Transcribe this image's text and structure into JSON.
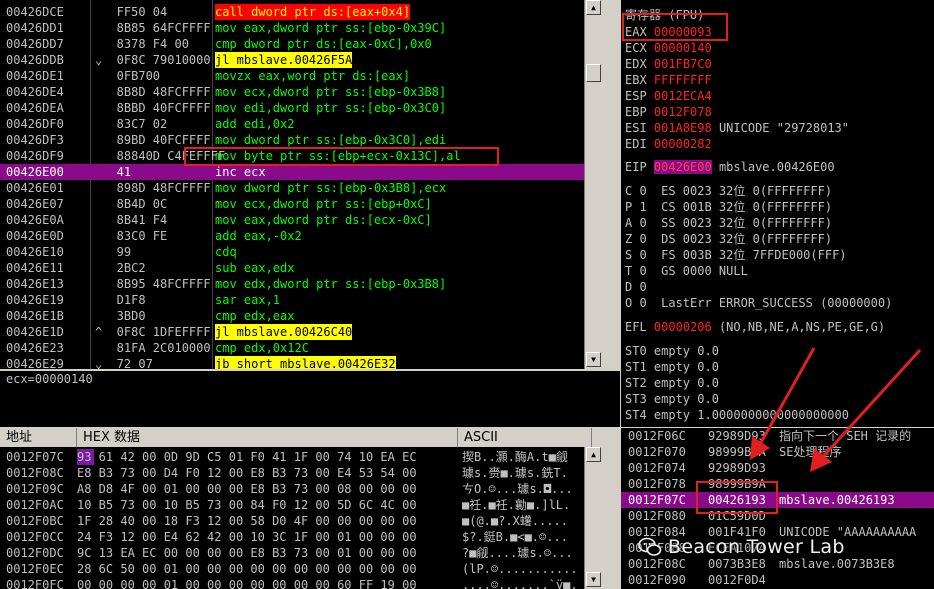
{
  "disasm": {
    "rows": [
      {
        "addr": "00426DCE",
        "hex": "   FF50 04",
        "asm": "call dword ptr ds:[eax+0x4]",
        "style": "call"
      },
      {
        "addr": "00426DD1",
        "hex": "   8B85 64FCFFFF",
        "asm": "mov eax,dword ptr ss:[ebp-0x39C]"
      },
      {
        "addr": "00426DD7",
        "hex": "   8378 F4 00",
        "asm": "cmp dword ptr ds:[eax-0xC],0x0"
      },
      {
        "addr": "00426DDB",
        "hex": "⌄  0F8C 79010000",
        "asm": "jl mbslave.00426F5A",
        "style": "jl"
      },
      {
        "addr": "00426DE1",
        "hex": "   0FB700",
        "asm": "movzx eax,word ptr ds:[eax]"
      },
      {
        "addr": "00426DE4",
        "hex": "   8B8D 48FCFFFF",
        "asm": "mov ecx,dword ptr ss:[ebp-0x3B8]"
      },
      {
        "addr": "00426DEA",
        "hex": "   8BBD 40FCFFFF",
        "asm": "mov edi,dword ptr ss:[ebp-0x3C0]"
      },
      {
        "addr": "00426DF0",
        "hex": "   83C7 02",
        "asm": "add edi,0x2"
      },
      {
        "addr": "00426DF3",
        "hex": "   89BD 40FCFFFF",
        "asm": "mov dword ptr ss:[ebp-0x3C0],edi"
      },
      {
        "addr": "00426DF9",
        "hex": "   88840D C4FEFFFF",
        "asm": "mov byte ptr ss:[ebp+ecx-0x13C],al"
      },
      {
        "addr": "00426E00",
        "hex": "   41",
        "asm": "inc ecx",
        "selected": true
      },
      {
        "addr": "00426E01",
        "hex": "   898D 48FCFFFF",
        "asm": "mov dword ptr ss:[ebp-0x3B8],ecx"
      },
      {
        "addr": "00426E07",
        "hex": "   8B4D 0C",
        "asm": "mov ecx,dword ptr ss:[ebp+0xC]"
      },
      {
        "addr": "00426E0A",
        "hex": "   8B41 F4",
        "asm": "mov eax,dword ptr ds:[ecx-0xC]"
      },
      {
        "addr": "00426E0D",
        "hex": "   83C0 FE",
        "asm": "add eax,-0x2"
      },
      {
        "addr": "00426E10",
        "hex": "   99",
        "asm": "cdq"
      },
      {
        "addr": "00426E11",
        "hex": "   2BC2",
        "asm": "sub eax,edx"
      },
      {
        "addr": "00426E13",
        "hex": "   8B95 48FCFFFF",
        "asm": "mov edx,dword ptr ss:[ebp-0x3B8]"
      },
      {
        "addr": "00426E19",
        "hex": "   D1F8",
        "asm": "sar eax,1"
      },
      {
        "addr": "00426E1B",
        "hex": "   3BD0",
        "asm": "cmp edx,eax"
      },
      {
        "addr": "00426E1D",
        "hex": "^  0F8C 1DFEFFFF",
        "asm": "jl mbslave.00426C40",
        "style": "jl"
      },
      {
        "addr": "00426E23",
        "hex": "   81FA 2C010000",
        "asm": "cmp edx,0x12C"
      },
      {
        "addr": "00426E29",
        "hex": "⌄  72 07",
        "asm": "jb short mbslave.00426E32",
        "style": "jl"
      }
    ]
  },
  "info": {
    "text": "ecx=00000140"
  },
  "registers": {
    "header": "寄存器 (FPU)",
    "gp": [
      {
        "name": "EAX",
        "value": "00000093",
        "comment": ""
      },
      {
        "name": "ECX",
        "value": "00000140",
        "comment": ""
      },
      {
        "name": "EDX",
        "value": "001FB7C0",
        "comment": ""
      },
      {
        "name": "EBX",
        "value": "FFFFFFFF",
        "comment": ""
      },
      {
        "name": "ESP",
        "value": "0012ECA4",
        "comment": ""
      },
      {
        "name": "EBP",
        "value": "0012F078",
        "comment": ""
      },
      {
        "name": "ESI",
        "value": "001A8E98",
        "comment": "UNICODE \"29728013\""
      },
      {
        "name": "EDI",
        "value": "00000282",
        "comment": ""
      }
    ],
    "eip": {
      "name": "EIP",
      "value": "00426E00",
      "comment": "mbslave.00426E00"
    },
    "flags": [
      {
        "text": "C 0  ES 0023 32位 0(FFFFFFFF)"
      },
      {
        "text": "P 1  CS 001B 32位 0(FFFFFFFF)"
      },
      {
        "text": "A 0  SS 0023 32位 0(FFFFFFFF)"
      },
      {
        "text": "Z 0  DS 0023 32位 0(FFFFFFFF)"
      },
      {
        "text": "S 0  FS 003B 32位 7FFDE000(FFF)"
      },
      {
        "text": "T 0  GS 0000 NULL"
      },
      {
        "text": "D 0"
      },
      {
        "text": "O 0  LastErr ERROR_SUCCESS (00000000)"
      }
    ],
    "efl": {
      "name": "EFL",
      "value": "00000206",
      "comment": "(NO,NB,NE,A,NS,PE,GE,G)"
    },
    "fpu": [
      {
        "text": "ST0 empty 0.0"
      },
      {
        "text": "ST1 empty 0.0"
      },
      {
        "text": "ST2 empty 0.0"
      },
      {
        "text": "ST3 empty 0.0"
      },
      {
        "text": "ST4 empty 1.0000000000000000000"
      }
    ]
  },
  "hexdump": {
    "headers": {
      "addr": "地址",
      "hex": "HEX 数据",
      "ascii": "ASCII"
    },
    "rows": [
      {
        "addr": "0012F07C",
        "bytes": "93 61 42 00 0D 9D C5 01 F0 41 1F 00 74 10 EA EC",
        "ascii": "揳B..灝.酶A.t■觎"
      },
      {
        "addr": "0012F08C",
        "bytes": "E8 B3 73 00 D4 F0 12 00 E8 B3 73 00 E4 53 54 00",
        "ascii": "璩s.赍■.璩s.銑T."
      },
      {
        "addr": "0012F09C",
        "bytes": "A8 D8 4F 00 01 00 00 00 E8 B3 73 00 08 00 00 00",
        "ascii": "ㄘO.☺...璩s.◘..."
      },
      {
        "addr": "0012F0AC",
        "bytes": "10 B5 73 00 10 B5 73 00 84 F0 12 00 5D 6C 4C 00",
        "ascii": "■祍.■祍.勷■.]lL."
      },
      {
        "addr": "0012F0BC",
        "bytes": "1F 28 40 00 18 F3 12 00 58 D0 4F 00 00 00 00 00",
        "ascii": "■(@.■?.X蠴....."
      },
      {
        "addr": "0012F0CC",
        "bytes": "24 F3 12 00 E4 62 42 00 10 3C 1F 00 01 00 00 00",
        "ascii": "$?.鋌B.■<■.☺..."
      },
      {
        "addr": "0012F0DC",
        "bytes": "9C 13 EA EC 00 00 00 00 E8 B3 73 00 01 00 00 00",
        "ascii": "?■觎....璩s.☺..."
      },
      {
        "addr": "0012F0EC",
        "bytes": "28 6C 50 00 01 00 00 00 00 00 00 00 00 00 00 00",
        "ascii": "(lP.☺..........."
      },
      {
        "addr": "0012F0FC",
        "bytes": "00 00 00 00 01 00 00 00 00 00 00 00 60 FF 19 00",
        "ascii": "....☺.......`ÿ■."
      }
    ]
  },
  "stack": {
    "rows": [
      {
        "addr": "0012F06C",
        "value": "92989D93",
        "comment": "指向下一个 SEH 记录的"
      },
      {
        "addr": "0012F070",
        "value": "98999B9A",
        "comment": "SE处理程序"
      },
      {
        "addr": "0012F074",
        "value": "92989D93",
        "comment": ""
      },
      {
        "addr": "0012F078",
        "value": "98999B9A",
        "comment": ""
      },
      {
        "addr": "0012F07C",
        "value": "00426193",
        "comment": "mbslave.00426193",
        "selected": true
      },
      {
        "addr": "0012F080",
        "value": "01C59D0D",
        "comment": ""
      },
      {
        "addr": "0012F084",
        "value": "001F41F0",
        "comment": "UNICODE \"AAAAAAAAAA"
      },
      {
        "addr": "0012F088",
        "value": "ECEA1074",
        "comment": ""
      },
      {
        "addr": "0012F08C",
        "value": "0073B3E8",
        "comment": "mbslave.0073B3E8"
      },
      {
        "addr": "0012F090",
        "value": "0012F0D4",
        "comment": ""
      }
    ]
  },
  "watermark": {
    "text": "Beacon Tower Lab"
  },
  "colors": {
    "asm_green": "#00ff00",
    "highlight_purple": "#8b0a8b",
    "reg_red": "#ff2020",
    "annotation_red": "#e02020",
    "call_bg": "#ff0000",
    "jump_bg": "#ffff00"
  }
}
